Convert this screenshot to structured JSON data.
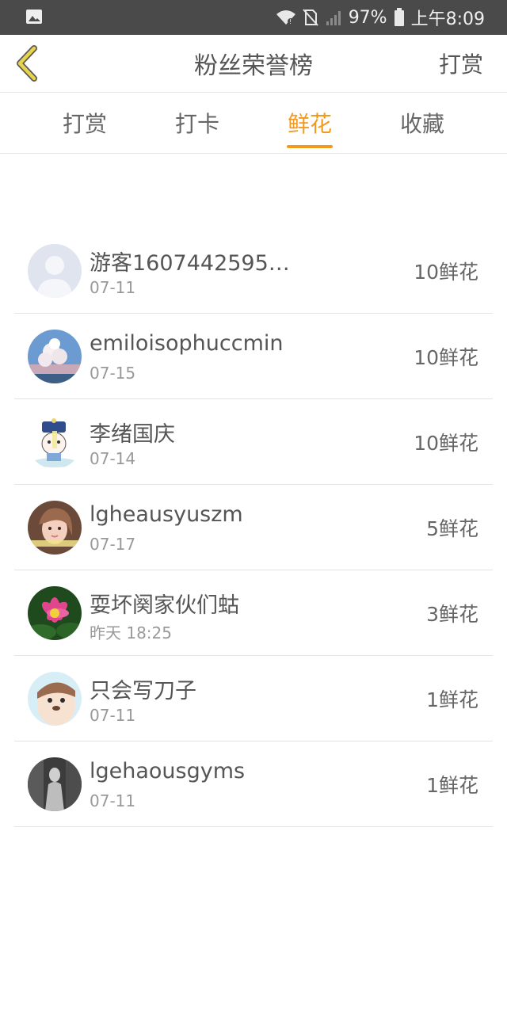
{
  "status_bar": {
    "battery_percent": "97%",
    "time": "上午8:09",
    "icons": [
      "image-icon",
      "wifi-icon",
      "no-sim-icon",
      "signal-icon",
      "battery-icon"
    ]
  },
  "header": {
    "title": "粉丝荣誉榜",
    "action_label": "打赏",
    "back_icon": "chevron-left-icon",
    "accent_color": "#f39a1e",
    "back_icon_color": "#e8d44a"
  },
  "tabs": [
    {
      "label": "打赏",
      "active": false
    },
    {
      "label": "打卡",
      "active": false
    },
    {
      "label": "鲜花",
      "active": true
    },
    {
      "label": "收藏",
      "active": false
    }
  ],
  "fans": [
    {
      "name": "游客1607442595…",
      "date": "07-11",
      "count": "10鲜花",
      "avatar": "default-user-avatar"
    },
    {
      "name": "emiloisophuccmin",
      "date": "07-15",
      "count": "10鲜花",
      "avatar": "cloud-sky-avatar"
    },
    {
      "name": "李绪国庆",
      "date": "07-14",
      "count": "10鲜花",
      "avatar": "cartoon-character-avatar"
    },
    {
      "name": "lgheausyuszm",
      "date": "07-17",
      "count": "5鲜花",
      "avatar": "girl-photo-avatar"
    },
    {
      "name": "耍坏阕家伙们蛄",
      "date": "昨天 18:25",
      "count": "3鲜花",
      "avatar": "lotus-flower-avatar"
    },
    {
      "name": "只会写刀子",
      "date": "07-11",
      "count": "1鲜花",
      "avatar": "cartoon-bear-avatar"
    },
    {
      "name": "lgehaousgyms",
      "date": "07-11",
      "count": "1鲜花",
      "avatar": "dark-figure-avatar"
    }
  ]
}
